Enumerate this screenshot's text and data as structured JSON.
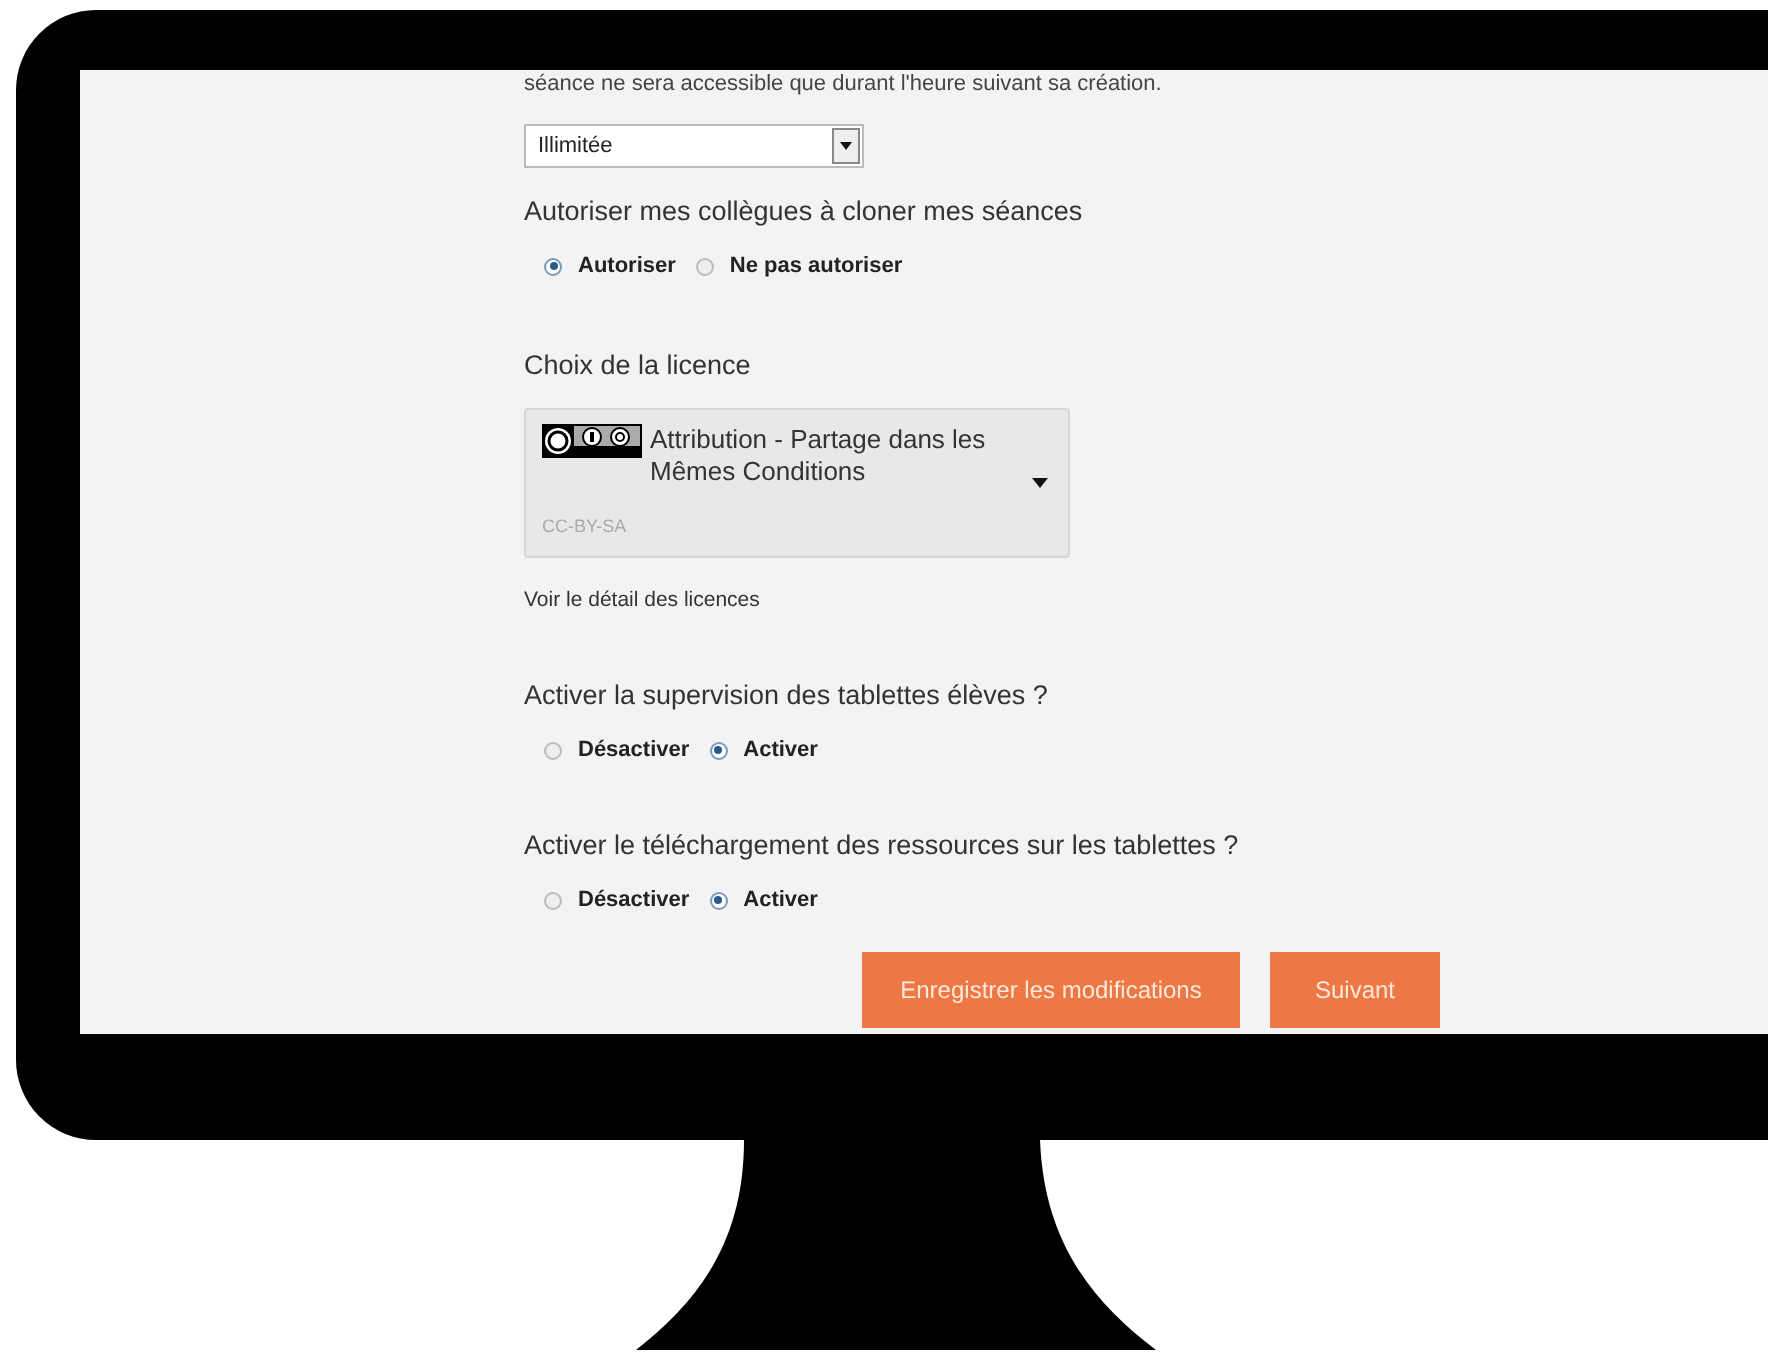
{
  "intro_text": "séance ne sera accessible que durant l'heure suivant sa création.",
  "duration_select": {
    "value": "Illimitée"
  },
  "sections": [
    {
      "kind": "radio",
      "title": "Autoriser mes collègues à cloner mes séances",
      "options": [
        {
          "label": "Autoriser",
          "selected": true
        },
        {
          "label": "Ne pas autoriser",
          "selected": false
        }
      ]
    },
    {
      "kind": "license",
      "title": "Choix de la licence",
      "license": {
        "name": "Attribution - Partage dans les Mêmes Conditions",
        "code": "CC-BY-SA"
      },
      "link": "Voir le détail des licences"
    },
    {
      "kind": "radio",
      "title": "Activer la supervision des tablettes élèves ?",
      "options": [
        {
          "label": "Désactiver",
          "selected": false
        },
        {
          "label": "Activer",
          "selected": true
        }
      ]
    },
    {
      "kind": "radio",
      "title": "Activer le téléchargement des ressources sur les tablettes ?",
      "options": [
        {
          "label": "Désactiver",
          "selected": false
        },
        {
          "label": "Activer",
          "selected": true
        }
      ]
    }
  ],
  "buttons": [
    "Enregistrer les modifications",
    "Suivant"
  ]
}
